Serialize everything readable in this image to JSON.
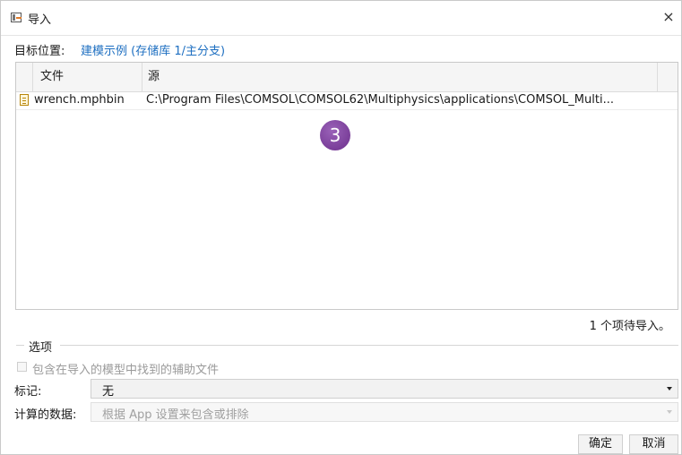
{
  "window": {
    "title": "导入",
    "icon": "import-icon",
    "close": "×"
  },
  "target": {
    "label": "目标位置:",
    "value": "建模示例 (存储库 1/主分支)",
    "value_color": "#1e6fc1"
  },
  "table": {
    "headers": {
      "file": "文件",
      "source": "源"
    },
    "rows": [
      {
        "icon": "file-icon",
        "file": "wrench.mphbin",
        "source": "C:\\Program Files\\COMSOL\\COMSOL62\\Multiphysics\\applications\\COMSOL_Multi..."
      }
    ]
  },
  "badge": {
    "text": "3",
    "color": "#7a3a9c"
  },
  "status": {
    "pending_text": "1 个项待导入。"
  },
  "options": {
    "section_label": "选项",
    "include_aux_files": {
      "label": "包含在导入的模型中找到的辅助文件",
      "checked": false,
      "enabled": false
    },
    "tag": {
      "label": "标记:",
      "value": "无"
    },
    "computed_data": {
      "label": "计算的数据:",
      "value": "根据 App 设置来包含或排除",
      "enabled": false
    }
  },
  "buttons": {
    "ok": "确定",
    "cancel": "取消"
  }
}
